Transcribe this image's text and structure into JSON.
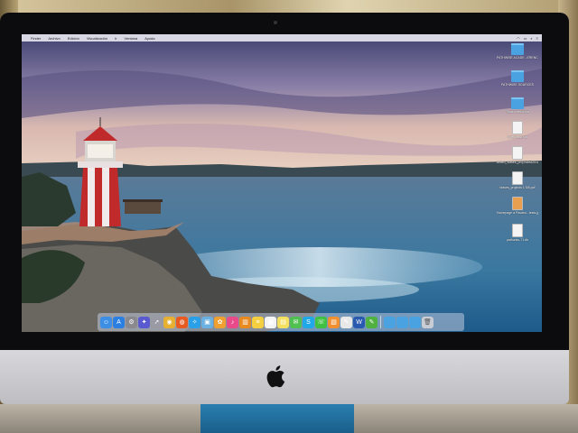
{
  "menubar": {
    "apple": "",
    "items": [
      "Finder",
      "Archivo",
      "Edición",
      "Visualización",
      "Ir",
      "Ventana",
      "Ayuda"
    ]
  },
  "desktop": {
    "icons": [
      {
        "label": "PATHWISE ACADE...ERENCE",
        "kind": "folder"
      },
      {
        "label": "PATHWISE SOURCES",
        "kind": "folder"
      },
      {
        "label": "Sans notebooks",
        "kind": "folder"
      },
      {
        "label": "invert/asst.pdf",
        "kind": "doc"
      },
      {
        "label": "aimed_biases_proj noted2018.pdf",
        "kind": "doc"
      },
      {
        "label": "biases_projects 1 5/8.pdf",
        "kind": "doc"
      },
      {
        "label": "Homepage a Pasdeu...tests.jpg",
        "kind": "image"
      },
      {
        "label": "pathunks-71.db",
        "kind": "doc"
      }
    ]
  },
  "dock": {
    "apps": [
      {
        "name": "finder-icon",
        "color": "#3d8fe6",
        "glyph": "☺"
      },
      {
        "name": "app-store-icon",
        "color": "#2a7fe0",
        "glyph": "A"
      },
      {
        "name": "settings-icon",
        "color": "#8a8a8e",
        "glyph": "⚙"
      },
      {
        "name": "launchpad-icon",
        "color": "#5a5ad0",
        "glyph": "✦"
      },
      {
        "name": "rocket-icon",
        "color": "#9a9aa4",
        "glyph": "➚"
      },
      {
        "name": "chrome-icon",
        "color": "#e8b030",
        "glyph": "◉"
      },
      {
        "name": "firefox-icon",
        "color": "#e85a20",
        "glyph": "◍"
      },
      {
        "name": "safari-icon",
        "color": "#2aa0e8",
        "glyph": "✧"
      },
      {
        "name": "preview-icon",
        "color": "#6ab0e0",
        "glyph": "▣"
      },
      {
        "name": "photos-icon",
        "color": "#f0a030",
        "glyph": "✿"
      },
      {
        "name": "itunes-icon",
        "color": "#e84a8a",
        "glyph": "♪"
      },
      {
        "name": "ibooks-icon",
        "color": "#e88a20",
        "glyph": "▥"
      },
      {
        "name": "notes-icon",
        "color": "#f4d040",
        "glyph": "≡"
      },
      {
        "name": "calendar-icon",
        "color": "#f4f4f4",
        "glyph": "▦"
      },
      {
        "name": "stickies-icon",
        "color": "#f4e060",
        "glyph": "▤"
      },
      {
        "name": "messages-icon",
        "color": "#50c050",
        "glyph": "✉"
      },
      {
        "name": "skype-icon",
        "color": "#20a8e8",
        "glyph": "S"
      },
      {
        "name": "facetime-icon",
        "color": "#40c040",
        "glyph": "☏"
      },
      {
        "name": "pages-icon",
        "color": "#f09030",
        "glyph": "▧"
      },
      {
        "name": "textedit-icon",
        "color": "#e8e8e8",
        "glyph": "✎"
      },
      {
        "name": "word-icon",
        "color": "#2a5ab0",
        "glyph": "W"
      },
      {
        "name": "evernote-icon",
        "color": "#50b040",
        "glyph": "✎"
      }
    ],
    "folders": [
      {
        "name": "downloads-folder-icon",
        "color": "#4aa3e0"
      },
      {
        "name": "documents-folder-icon",
        "color": "#4aa3e0"
      },
      {
        "name": "applications-folder-icon",
        "color": "#4aa3e0"
      }
    ],
    "trash": {
      "name": "trash-icon",
      "color": "#c8ccd4"
    }
  }
}
